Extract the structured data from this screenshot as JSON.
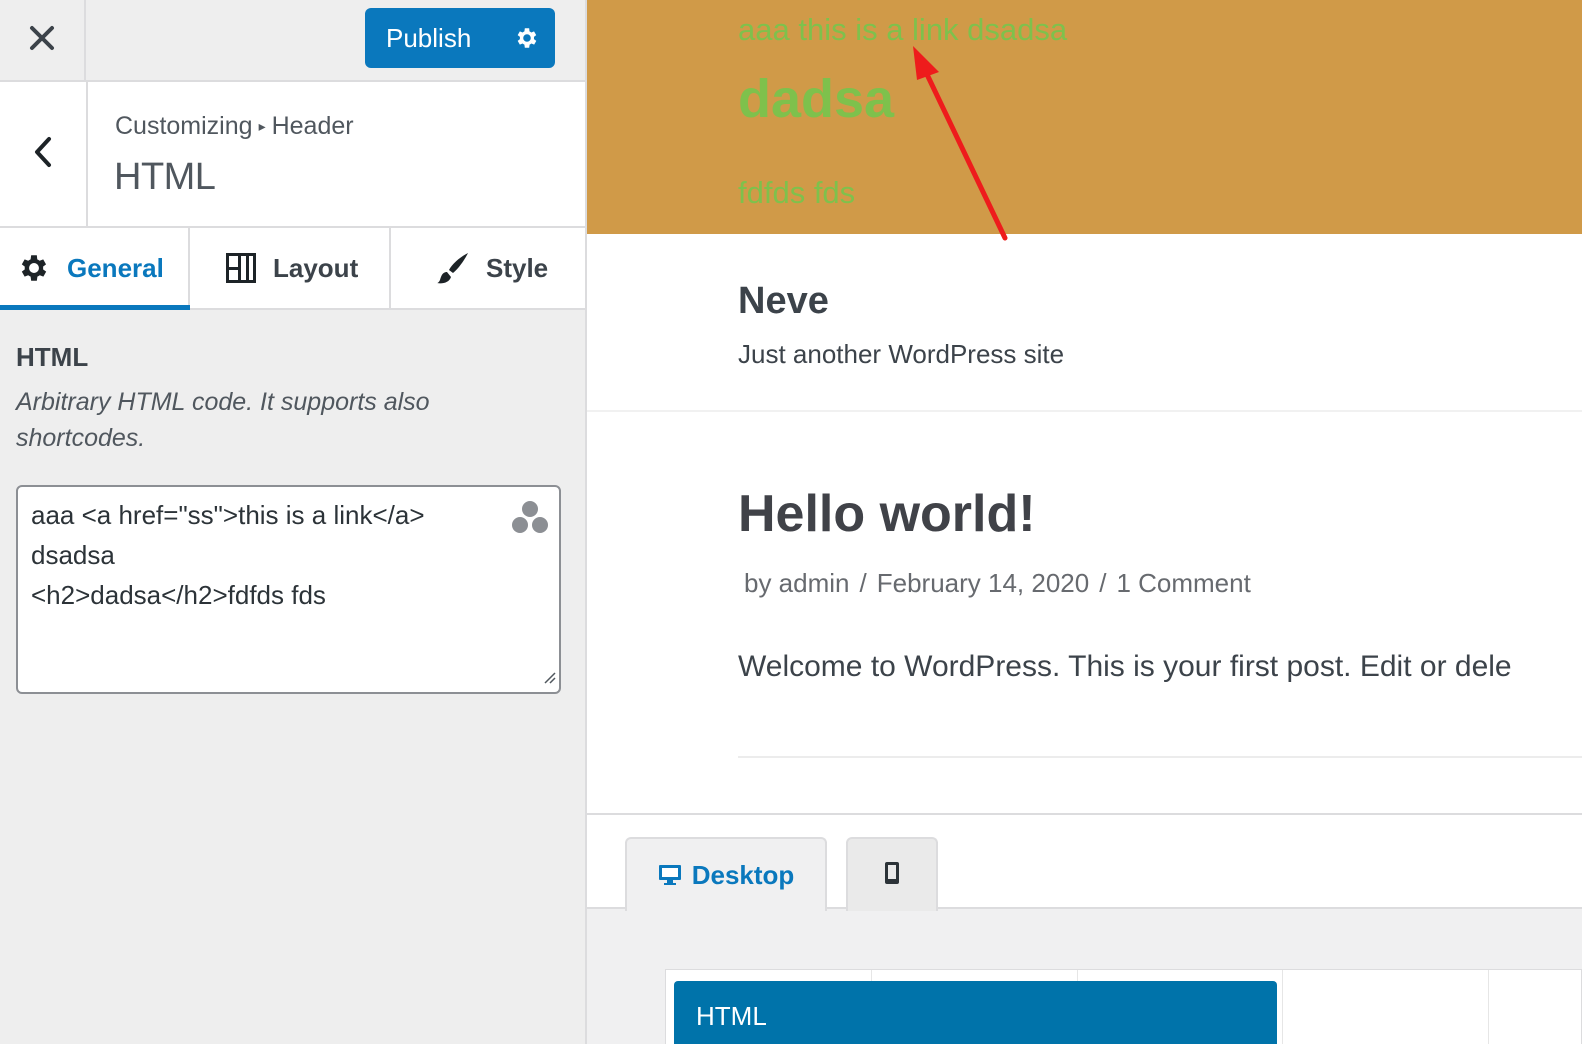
{
  "topbar": {
    "close_icon": "close-icon",
    "publish_label": "Publish",
    "publish_settings_icon": "gear-icon",
    "accent": "#0a78bd"
  },
  "section": {
    "breadcrumb_root": "Customizing",
    "breadcrumb_separator": "▸",
    "breadcrumb_current": "Header",
    "title": "HTML",
    "back_icon": "chevron-left-icon"
  },
  "tabs": [
    {
      "label": "General",
      "icon": "gear-icon",
      "active": true
    },
    {
      "label": "Layout",
      "icon": "layout-icon",
      "active": false
    },
    {
      "label": "Style",
      "icon": "brush-icon",
      "active": false
    }
  ],
  "control": {
    "title": "HTML",
    "description": "Arbitrary HTML code. It supports also shortcodes.",
    "code": "aaa <a href=\"ss\">this is a link</a>\ndsadsa\n<h2>dadsa</h2>fdfds fds",
    "shortcode_icon": "shortcodes-icon"
  },
  "preview": {
    "header_html": {
      "line1": "aaa this is a link dsadsa",
      "heading": "dadsa",
      "line3": "fdfds fds",
      "background": "#d09a48",
      "text_color": "#7ec14c",
      "annotation": "red-arrow"
    },
    "site_title": "Neve",
    "site_tagline": "Just another WordPress site",
    "post": {
      "title": "Hello world!",
      "meta_by": "by admin",
      "meta_sep": "/",
      "meta_date": "February 14, 2020",
      "meta_comments": "1 Comment",
      "excerpt": "Welcome to WordPress. This is your first post. Edit or dele"
    },
    "builder": {
      "desktop_label": "Desktop",
      "desktop_icon": "desktop-icon",
      "mobile_icon": "mobile-icon",
      "component_label": "HTML"
    }
  }
}
